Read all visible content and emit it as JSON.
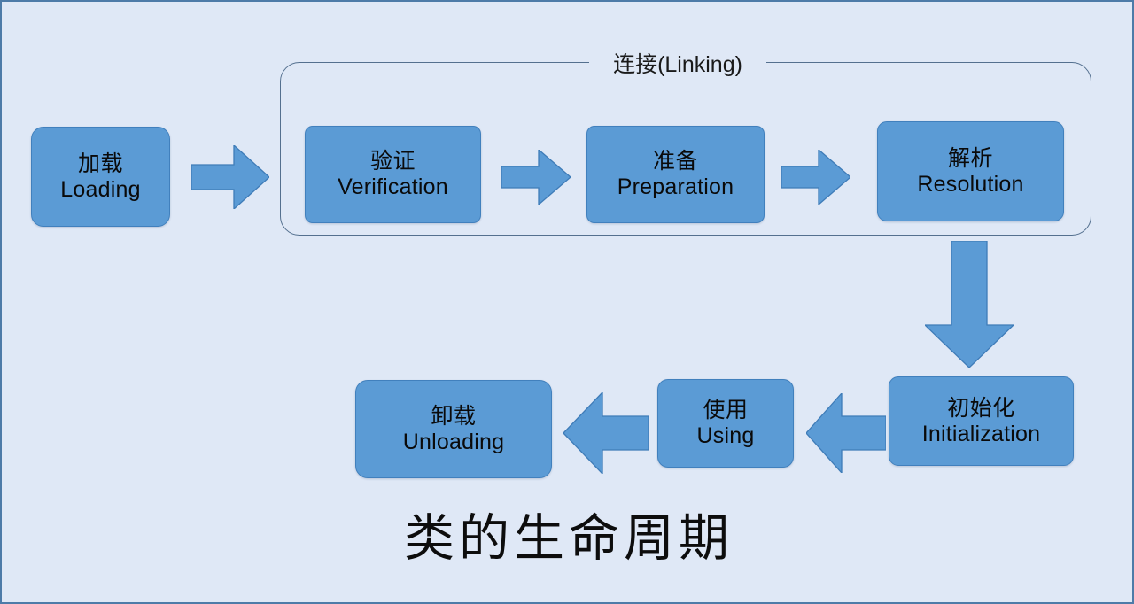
{
  "diagram": {
    "title": "类的生命周期",
    "background_color": "#dfe8f6",
    "node_fill_color": "#5b9bd5",
    "node_border_color": "#4180bd",
    "arrow_fill_color": "#5b9bd5",
    "arrow_border_color": "#3f7cb8",
    "group_border_color": "#54708f"
  },
  "group": {
    "label": "连接(Linking)"
  },
  "nodes": {
    "loading": {
      "cn": "加载",
      "en": "Loading"
    },
    "verification": {
      "cn": "验证",
      "en": "Verification"
    },
    "preparation": {
      "cn": "准备",
      "en": "Preparation"
    },
    "resolution": {
      "cn": "解析",
      "en": "Resolution"
    },
    "initialization": {
      "cn": "初始化",
      "en": "Initialization"
    },
    "using": {
      "cn": "使用",
      "en": "Using"
    },
    "unloading": {
      "cn": "卸载",
      "en": "Unloading"
    }
  },
  "flow": [
    {
      "from": "loading",
      "to": "verification",
      "direction": "right"
    },
    {
      "from": "verification",
      "to": "preparation",
      "direction": "right"
    },
    {
      "from": "preparation",
      "to": "resolution",
      "direction": "right"
    },
    {
      "from": "resolution",
      "to": "initialization",
      "direction": "down"
    },
    {
      "from": "initialization",
      "to": "using",
      "direction": "left"
    },
    {
      "from": "using",
      "to": "unloading",
      "direction": "left"
    }
  ]
}
